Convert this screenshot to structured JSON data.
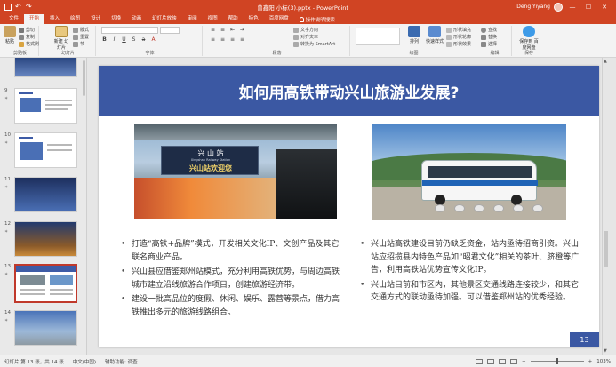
{
  "titlebar": {
    "doc_title": "曾鑫阳 小标(3).pptx  -  PowerPoint",
    "user_name": "Deng Yiyang",
    "min": "—",
    "max": "☐",
    "close": "✕"
  },
  "tabs": [
    "文件",
    "开始",
    "插入",
    "绘图",
    "设计",
    "切换",
    "动画",
    "幻灯片放映",
    "审阅",
    "视图",
    "帮助",
    "特色",
    "百度网盘"
  ],
  "active_tab_index": 1,
  "tell_me": "操作说明搜索",
  "ribbon": {
    "paste": "粘贴",
    "cut": "剪切",
    "copy": "复制",
    "format_painter": "格式刷",
    "clipboard_label": "剪贴板",
    "new_slide": "新建\n幻灯片",
    "layout": "版式",
    "reset": "重置",
    "section": "节",
    "slides_label": "幻灯片",
    "font_label": "字体",
    "text_direction": "文字方向",
    "align_text": "对齐文本",
    "smartart": "转换为 SmartArt",
    "paragraph_label": "段落",
    "drawing_label": "绘图",
    "arrange": "排列",
    "quick_styles": "快速样式",
    "shape_fill": "形状填充",
    "shape_outline": "形状轮廓",
    "shape_effects": "形状效果",
    "find": "查找",
    "replace": "替换",
    "select": "选择",
    "editing_label": "编辑",
    "save_to_cloud": "保存到\n百度网盘",
    "save_label": "保存"
  },
  "thumbnails": [
    {
      "num": "",
      "kind": "photo"
    },
    {
      "num": "9",
      "kind": "content"
    },
    {
      "num": "10",
      "kind": "content"
    },
    {
      "num": "11",
      "kind": "dark"
    },
    {
      "num": "12",
      "kind": "dark"
    },
    {
      "num": "13",
      "kind": "content",
      "selected": true
    },
    {
      "num": "14",
      "kind": "dark"
    }
  ],
  "slide": {
    "title": "如何用高铁带动兴山旅游业发展?",
    "sign_name": "兴 山 站",
    "sign_en": "Xingshan Railway Station",
    "sign_welcome": "兴山站欢迎您",
    "bullets_left": [
      "打造“高铁+品牌”模式，开发相关文化IP、文创产品及其它联名商业产品。",
      "兴山县应借鉴郑州站模式，充分利用高铁优势，与周边高铁城市建立沿线旅游合作项目，创建旅游经济带。",
      "建设一批高品位的度假、休闲、娱乐、露营等景点，借力高铁推出多元的旅游线路组合。"
    ],
    "bullets_right": [
      "兴山站高铁建设目前仍缺乏资金，站内亟待招商引资。兴山站应招揽县内特色产品如“昭君文化”相关的茶叶、脐橙等广告，利用高铁站优势宣传文化IP。",
      "兴山站目前和市区内，其他景区交通线路连接较少，和其它交通方式的联动亟待加强。可以借鉴郑州站的优秀经验。"
    ],
    "slide_number": "13"
  },
  "status": {
    "slide_pos": "幻灯片 第 13 张，共 14 张",
    "language": "中文(中国)",
    "accessibility": "辅助功能: 调查",
    "zoom": "103%"
  },
  "colors": {
    "accent": "#d04423",
    "slide_blue": "#3b58a3"
  }
}
